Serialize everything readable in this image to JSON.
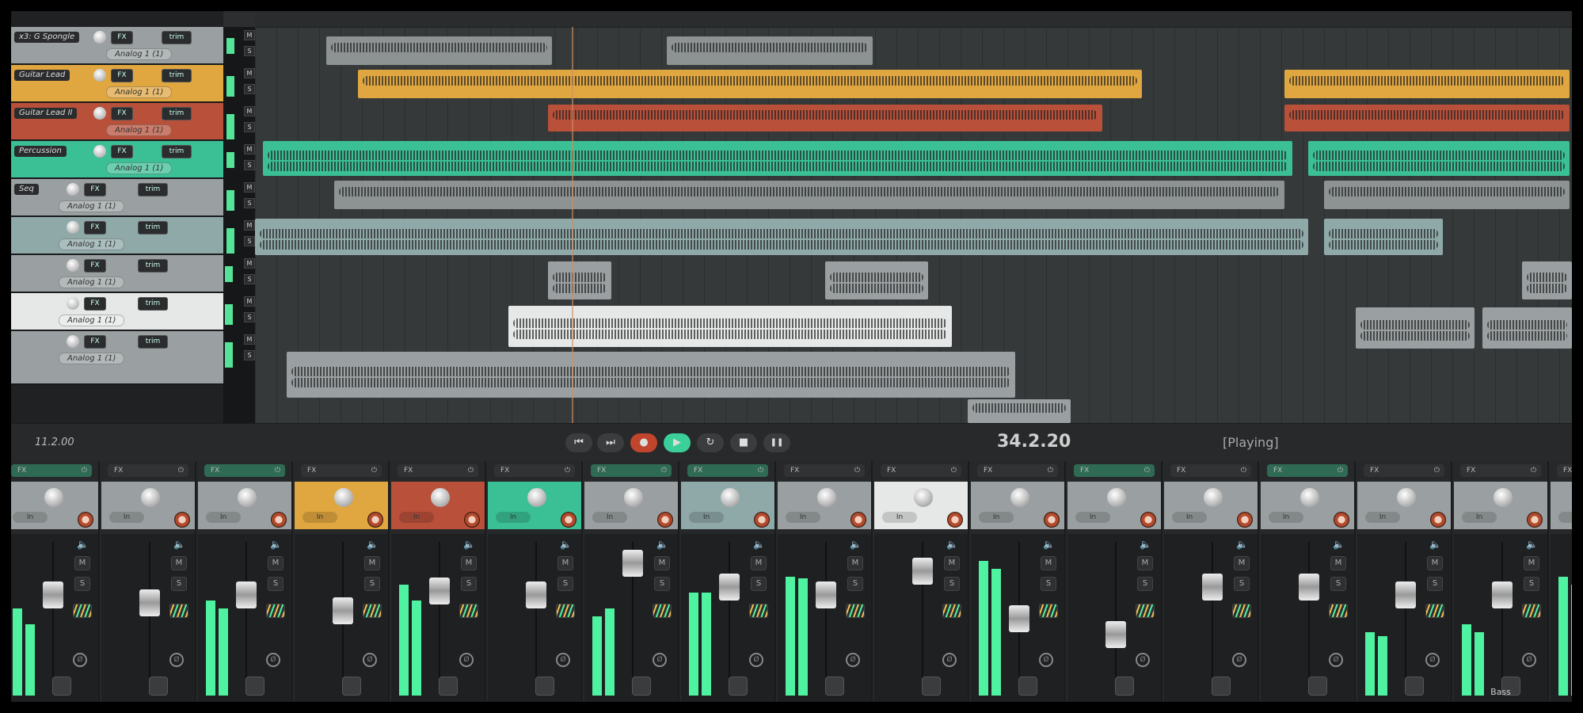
{
  "tcp": {
    "tracks": [
      {
        "name": "x3: G Spongle",
        "input": "Analog 1 (1)",
        "color": "#9aa0a2"
      },
      {
        "name": "Guitar Lead",
        "input": "Analog 1 (1)",
        "color": "#e0a640"
      },
      {
        "name": "Guitar Lead II",
        "input": "Analog 1 (1)",
        "color": "#b8503a"
      },
      {
        "name": "Percussion",
        "input": "Analog 1 (1)",
        "color": "#3bbf95"
      },
      {
        "name": "Seq",
        "input": "Analog 1 (1)",
        "color": "#9aa0a2"
      },
      {
        "name": "",
        "input": "Analog 1 (1)",
        "color": "#8fa9a9"
      },
      {
        "name": "",
        "input": "Analog 1 (1)",
        "color": "#9aa0a2"
      },
      {
        "name": "",
        "input": "Analog 1 (1)",
        "color": "#e6e8e8"
      },
      {
        "name": "",
        "input": "Analog 1 (1)",
        "color": "#9aa0a2"
      }
    ],
    "fx_label": "FX",
    "trim_label": "trim",
    "mute_label": "M",
    "solo_label": "S"
  },
  "transport": {
    "left_position": "11.2.00",
    "position": "34.2.20",
    "status": "[Playing]",
    "buttons": {
      "go_start": "⏮",
      "go_end": "⏭",
      "record": "●",
      "play": "▶",
      "repeat": "↻",
      "stop": "■",
      "pause": "❚❚"
    },
    "colors": {
      "record": "#c0452c",
      "play": "#3bd09a"
    }
  },
  "mixer": {
    "fx_label": "FX",
    "power_icon": "⏻",
    "in_label": "In",
    "mute_label": "M",
    "solo_label": "S",
    "phase_icon": "Ø",
    "last_strip_name": "Bass",
    "strips": [
      {
        "color": "#9aa0a2",
        "fx_on": true
      },
      {
        "color": "#9aa0a2",
        "fx_on": false
      },
      {
        "color": "#9aa0a2",
        "fx_on": true
      },
      {
        "color": "#e0a640",
        "fx_on": false
      },
      {
        "color": "#b8503a",
        "fx_on": false
      },
      {
        "color": "#3bbf95",
        "fx_on": false
      },
      {
        "color": "#9aa0a2",
        "fx_on": true
      },
      {
        "color": "#8fa9a9",
        "fx_on": true
      },
      {
        "color": "#9aa0a2",
        "fx_on": false
      },
      {
        "color": "#e6e8e8",
        "fx_on": false
      },
      {
        "color": "#9aa0a2",
        "fx_on": false
      },
      {
        "color": "#9aa0a2",
        "fx_on": true
      },
      {
        "color": "#9aa0a2",
        "fx_on": false
      },
      {
        "color": "#9aa0a2",
        "fx_on": true
      },
      {
        "color": "#9aa0a2",
        "fx_on": false
      },
      {
        "color": "#9aa0a2",
        "fx_on": false
      },
      {
        "color": "#9aa0a2",
        "fx_on": false
      }
    ]
  },
  "arrange": {
    "accent": "#3bd09a"
  }
}
